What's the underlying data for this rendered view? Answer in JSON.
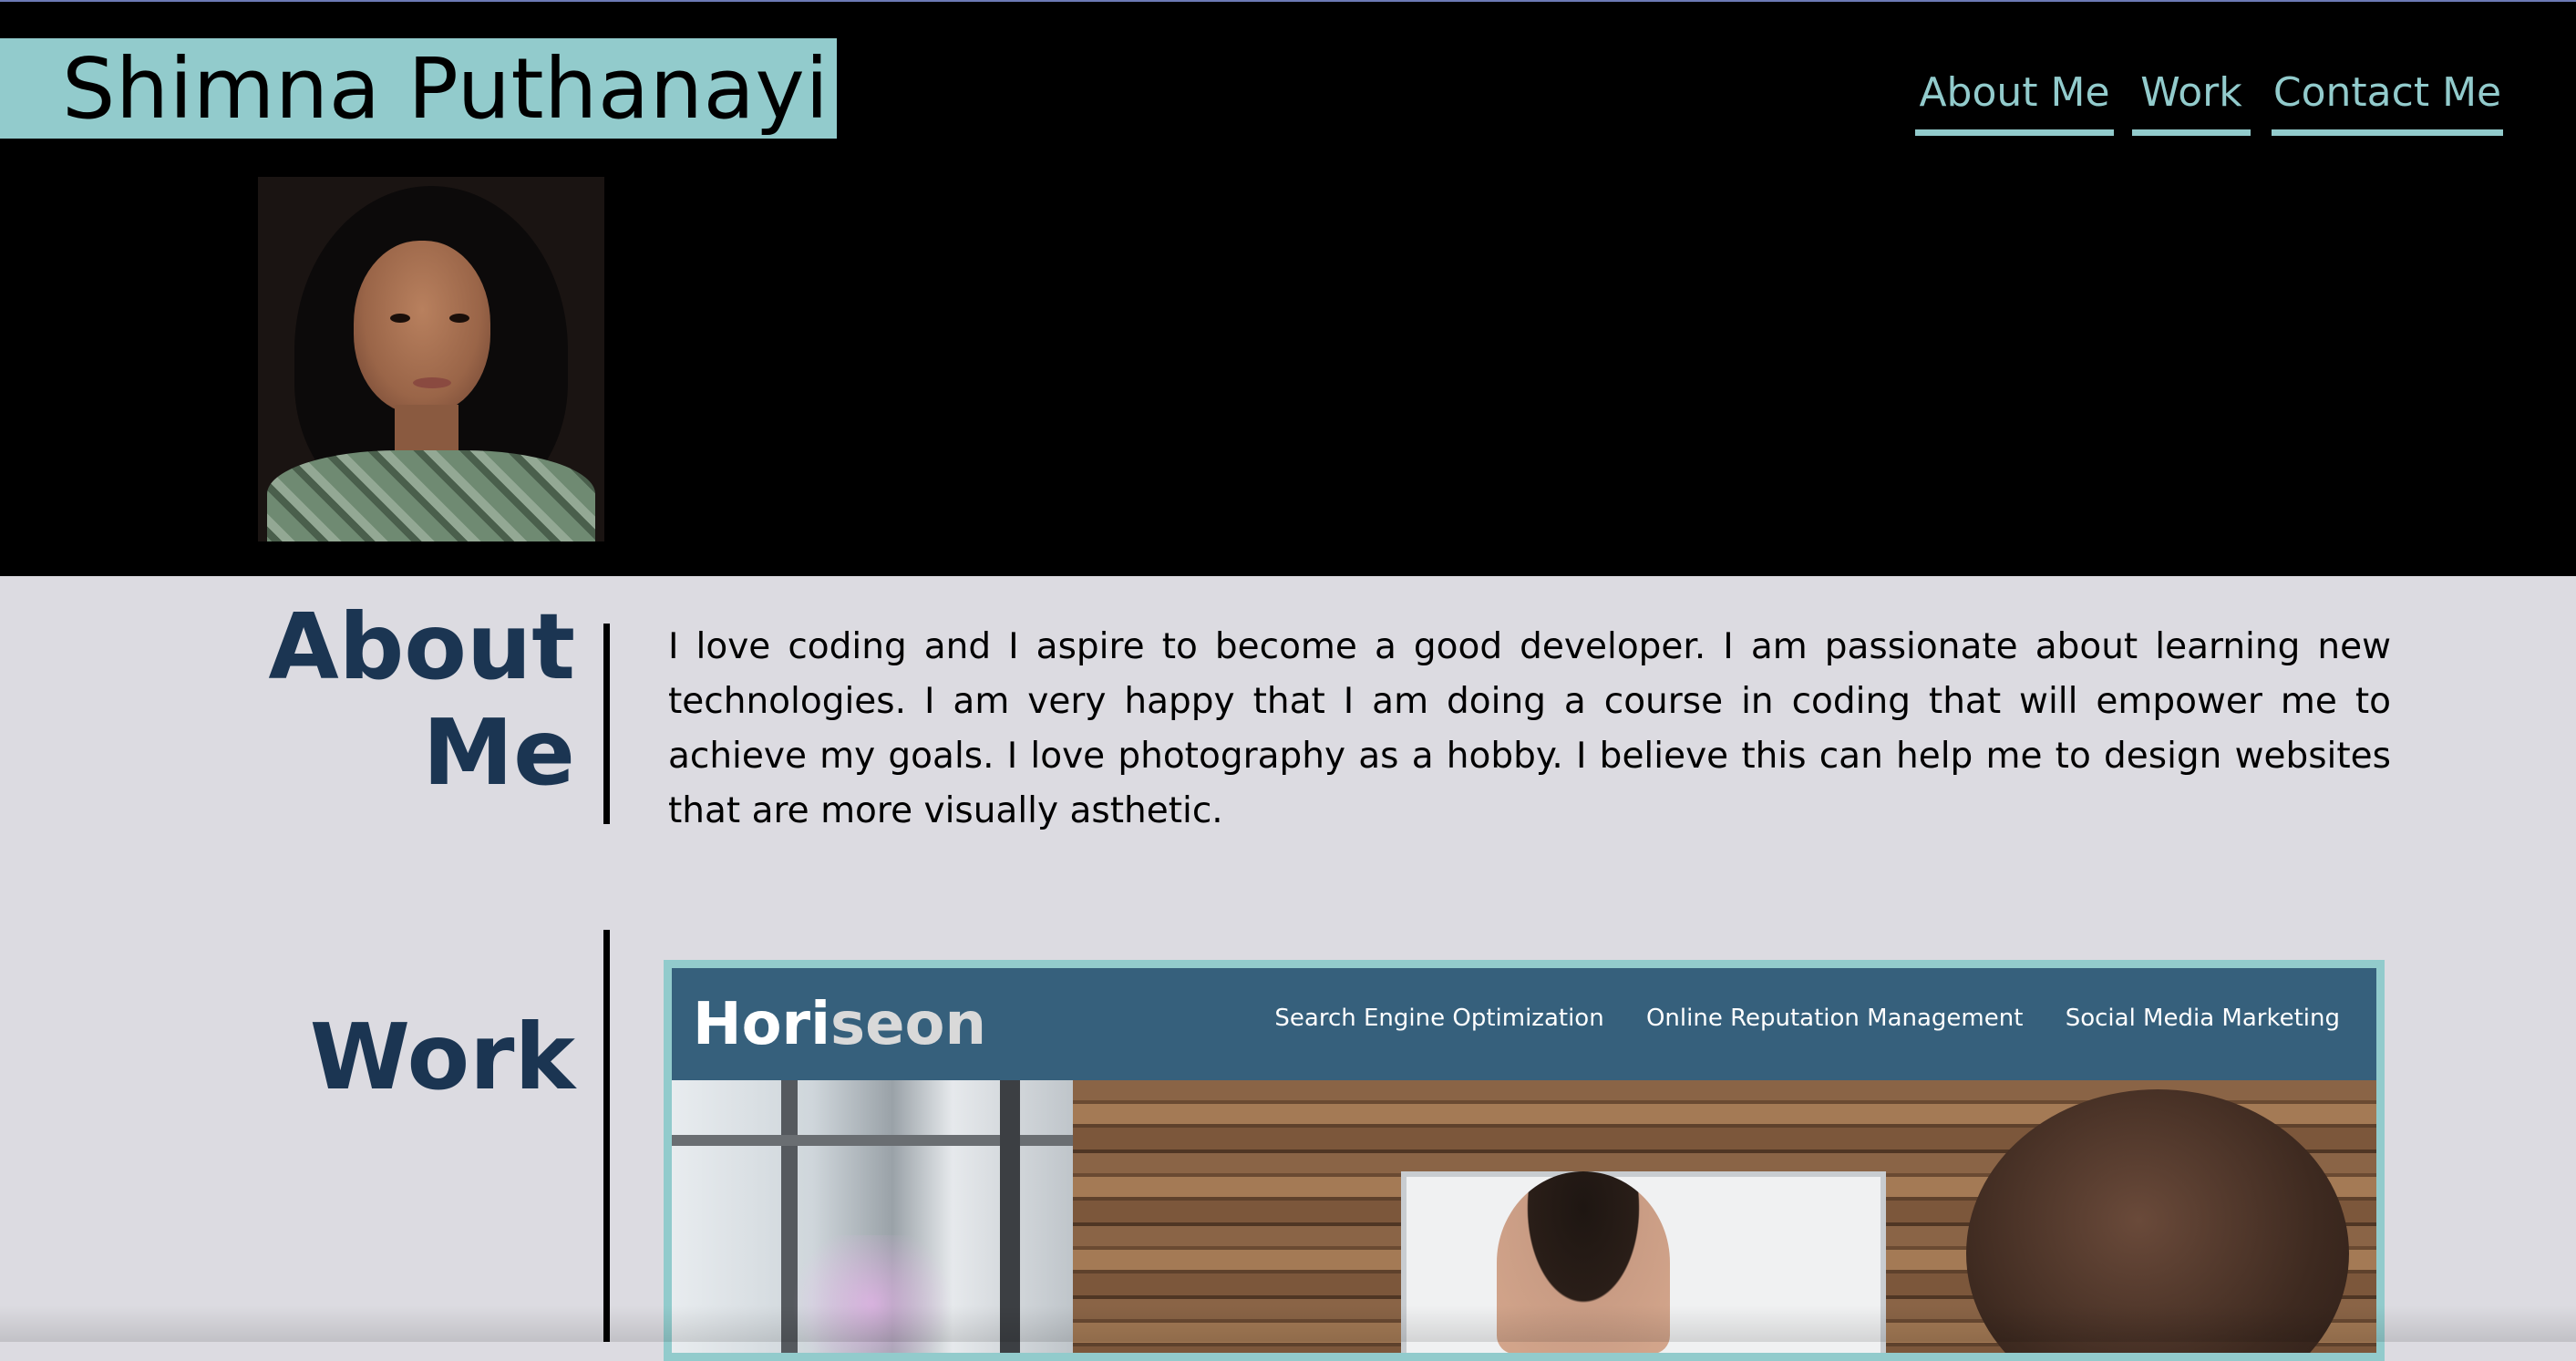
{
  "header": {
    "name": "Shimna Puthanayil",
    "nav": [
      {
        "label": "About Me"
      },
      {
        "label": "Work"
      },
      {
        "label": "Contact Me"
      }
    ]
  },
  "about": {
    "title_line1": "About",
    "title_line2": "Me",
    "text": "I love coding and I aspire to become a good developer. I am passionate about learning new technologies. I am very happy that I am doing a course in coding that will empower me to achieve my goals. I love photography as a hobby. I believe this can help me to design websites that are more visually asthetic."
  },
  "work": {
    "title": "Work",
    "project": {
      "logo_part1": "Hori",
      "logo_part2": "seon",
      "nav": [
        "Search Engine Optimization",
        "Online Reputation Management",
        "Social Media Marketing"
      ]
    }
  },
  "colors": {
    "accent": "#92cbcc",
    "heading": "#1b3552",
    "background": "#dcdbe1",
    "project_header": "#36607c"
  }
}
